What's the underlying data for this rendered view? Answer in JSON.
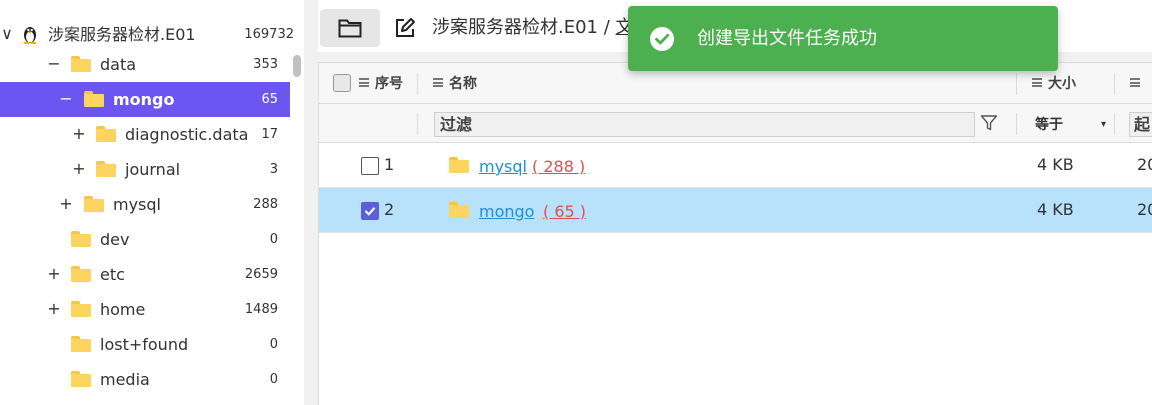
{
  "tree": {
    "root": {
      "label": "涉案服务器检材.E01",
      "count": "169732",
      "toggle": "∨"
    },
    "nodes": [
      {
        "label": "data",
        "count": "353",
        "toggle": "−"
      },
      {
        "label": "mongo",
        "count": "65",
        "toggle": "−",
        "selected": true
      },
      {
        "label": "diagnostic.data",
        "count": "17",
        "toggle": "+"
      },
      {
        "label": "journal",
        "count": "3",
        "toggle": "+"
      },
      {
        "label": "mysql",
        "count": "288",
        "toggle": "+"
      },
      {
        "label": "dev",
        "count": "0",
        "toggle": ""
      },
      {
        "label": "etc",
        "count": "2659",
        "toggle": "+"
      },
      {
        "label": "home",
        "count": "1489",
        "toggle": "+"
      },
      {
        "label": "lost+found",
        "count": "0",
        "toggle": ""
      },
      {
        "label": "media",
        "count": "0",
        "toggle": ""
      }
    ]
  },
  "toolbar": {
    "breadcrumb_root": "涉案服务器检材.E01",
    "breadcrumb_sep": "/",
    "breadcrumb_current": "文件"
  },
  "table": {
    "headers": {
      "index": "序号",
      "name": "名称",
      "size": "大小"
    },
    "filter": {
      "placeholder": "过滤",
      "size_operator": "等于",
      "size_caret": "▾",
      "date_from": "起"
    },
    "rows": [
      {
        "index": "1",
        "name": "mysql",
        "count": "( 288 )",
        "size": "4 KB",
        "date": "20",
        "checked": false
      },
      {
        "index": "2",
        "name": "mongo",
        "count": "( 65 )",
        "size": "4 KB",
        "date": "20",
        "checked": true
      }
    ]
  },
  "toast": {
    "message": "创建导出文件任务成功",
    "color": "#4caf50"
  },
  "colors": {
    "selected_tree": "#6c55f0",
    "selected_row": "#b8e2fb",
    "link": "#1e90d6",
    "count": "#e05050"
  }
}
